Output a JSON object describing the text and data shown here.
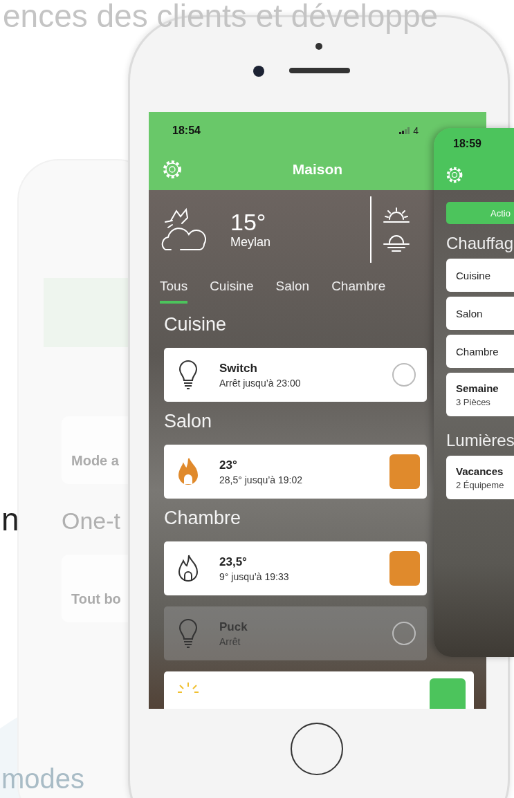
{
  "page_heading": "ences des clients et développe",
  "side_text": "n",
  "bottom_text": "modes",
  "ghost_app": {
    "cards": [
      "Mode a",
      "Tout bo"
    ],
    "heading": "One-t"
  },
  "phone_main": {
    "status_time": "18:54",
    "status_network": "4",
    "title": "Maison",
    "weather": {
      "temperature": "15°",
      "city": "Meylan"
    },
    "tabs": [
      {
        "label": "Tous",
        "selected": true
      },
      {
        "label": "Cuisine",
        "selected": false
      },
      {
        "label": "Salon",
        "selected": false
      },
      {
        "label": "Chambre",
        "selected": false
      }
    ],
    "sections": [
      {
        "title": "Cuisine",
        "devices": [
          {
            "kind": "light",
            "name": "Switch",
            "status": "Arrêt jusqu’à 23:00",
            "on": false,
            "disabled": false
          }
        ]
      },
      {
        "title": "Salon",
        "devices": [
          {
            "kind": "heat",
            "name": "23°",
            "status": "28,5° jusqu’à 19:02",
            "on": true,
            "disabled": false
          }
        ]
      },
      {
        "title": "Chambre",
        "devices": [
          {
            "kind": "heat",
            "name": "23,5°",
            "status": "9° jusqu’à 19:33",
            "on": false,
            "disabled": false
          },
          {
            "kind": "light",
            "name": "Puck",
            "status": "Arrêt",
            "on": false,
            "disabled": true
          }
        ]
      }
    ]
  },
  "phone_second": {
    "status_time": "18:59",
    "action_button": "Actio",
    "groups": [
      {
        "title": "Chauffag",
        "items": [
          {
            "kind": "room",
            "name": "Cuisine"
          },
          {
            "kind": "room",
            "name": "Salon"
          },
          {
            "kind": "room",
            "name": "Chambre"
          },
          {
            "kind": "scene",
            "name": "Semaine",
            "detail": "3 Pièces"
          }
        ]
      },
      {
        "title": "Lumières",
        "items": [
          {
            "kind": "scene",
            "name": "Vacances",
            "detail": "2 Équipeme"
          }
        ]
      }
    ]
  }
}
